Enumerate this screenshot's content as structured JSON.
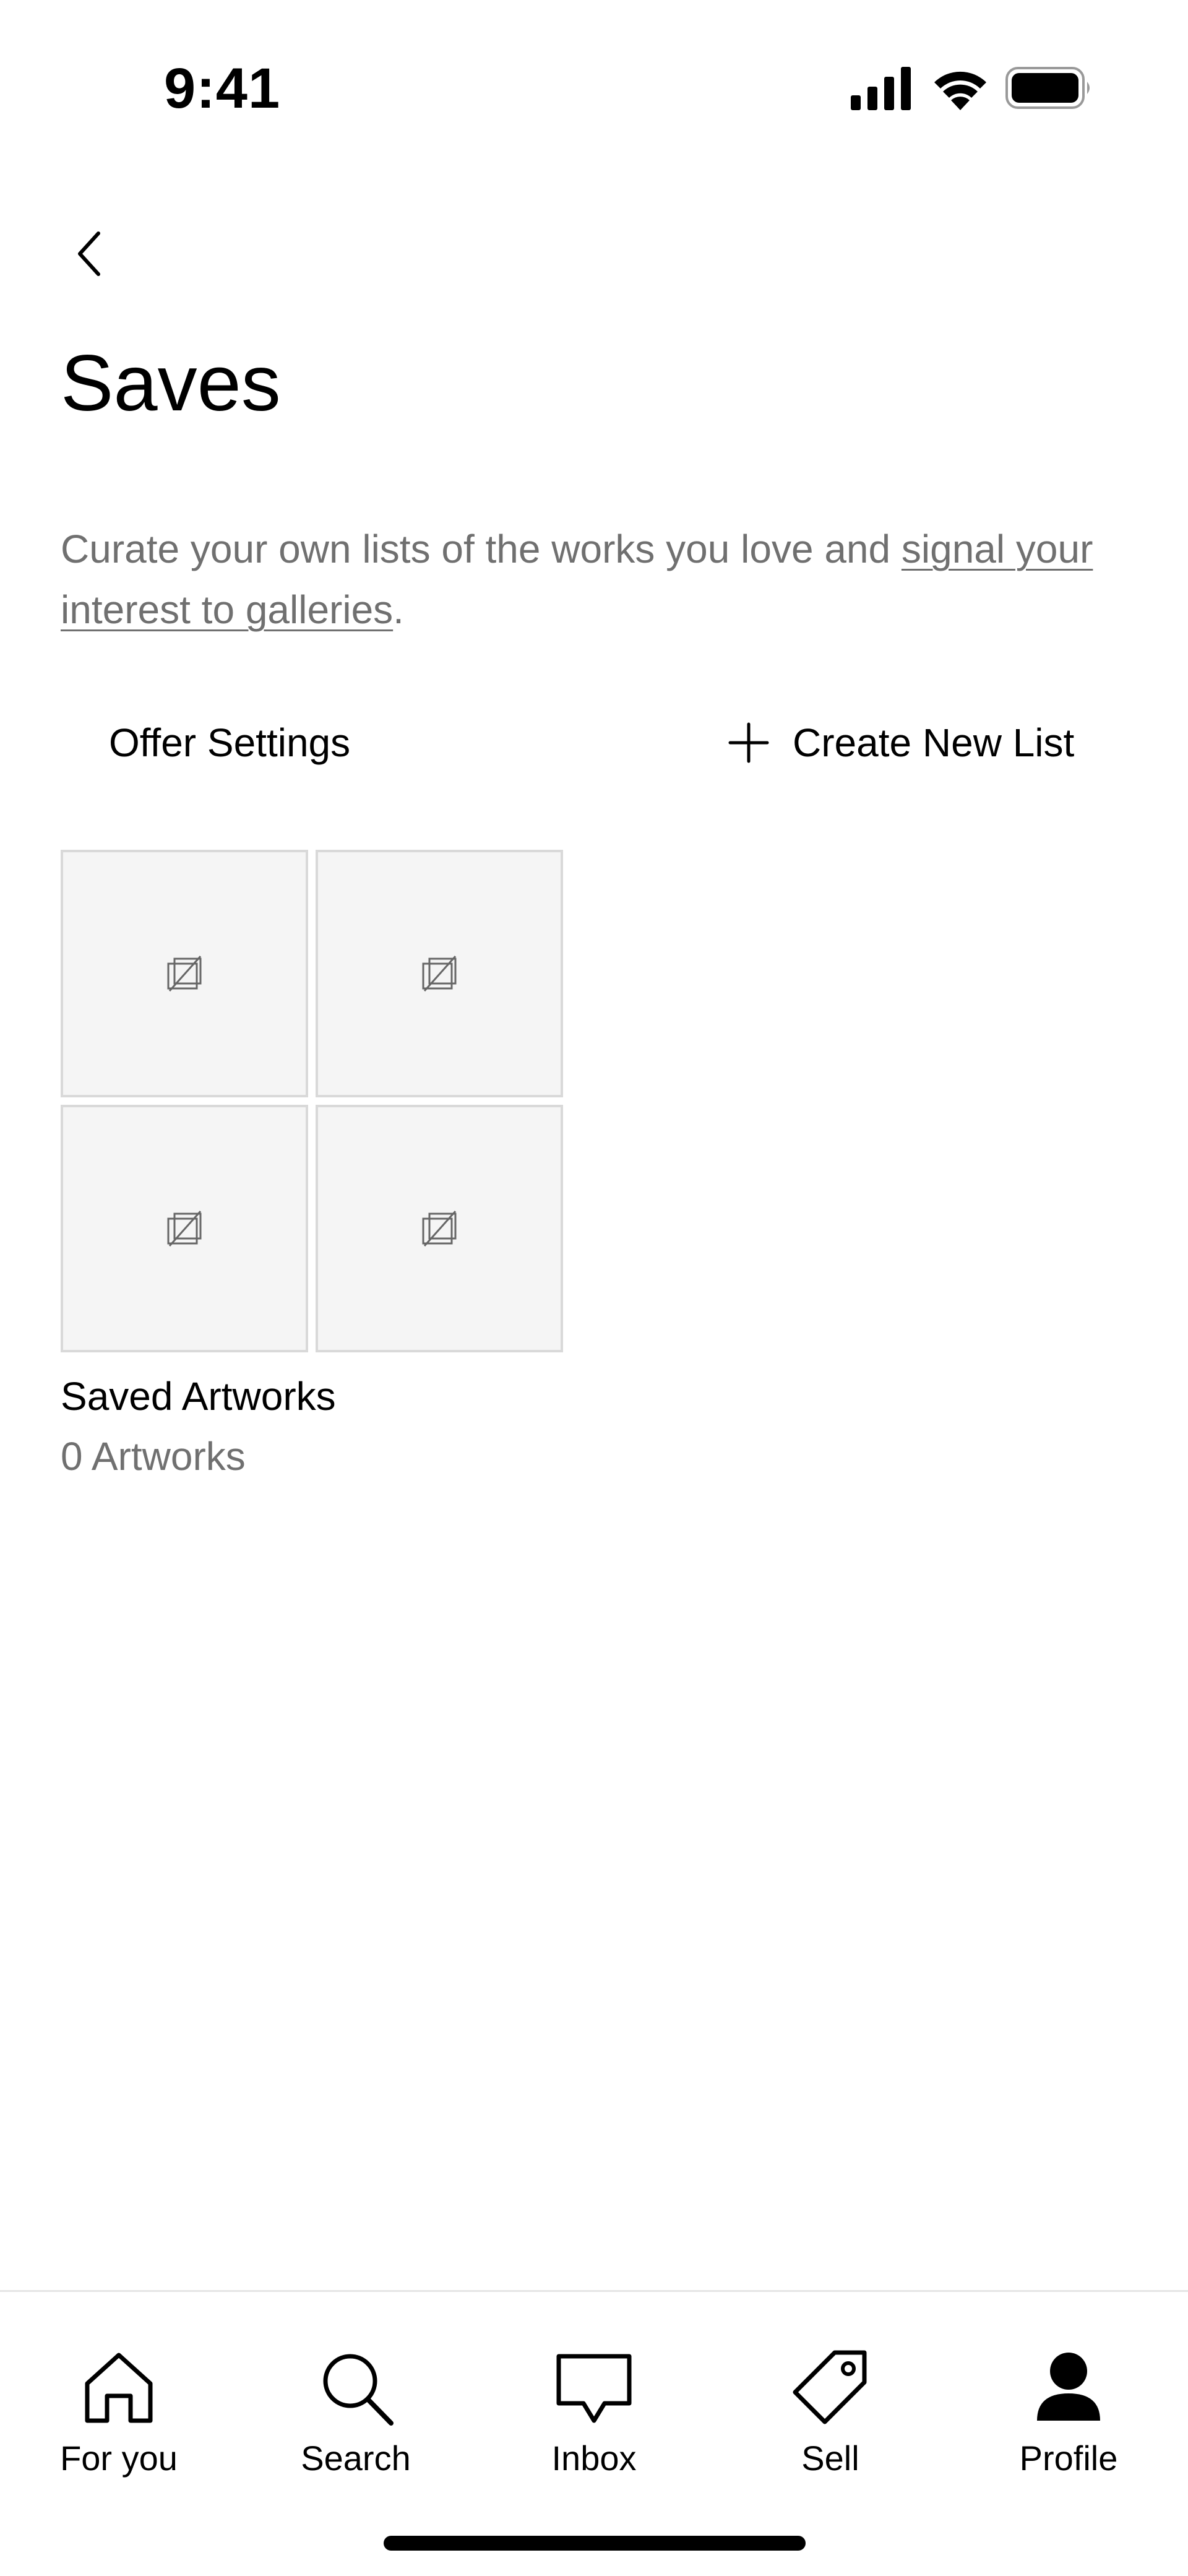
{
  "status_bar": {
    "time": "9:41",
    "icons": [
      "signal-icon",
      "wifi-icon",
      "battery-icon"
    ]
  },
  "header": {
    "back_icon": "chevron-left-icon",
    "title": "Saves"
  },
  "description": {
    "text_before": "Curate your own lists of the works you love and ",
    "link_text": "signal your interest to galleries",
    "text_after": "."
  },
  "actions": {
    "offer_settings_label": "Offer Settings",
    "create_list_label": "Create New List",
    "create_list_icon": "plus-icon"
  },
  "lists": [
    {
      "title": "Saved Artworks",
      "count_label": "0 Artworks",
      "thumbnail_icon": "image-unavailable-icon"
    }
  ],
  "bottom_nav": {
    "items": [
      {
        "label": "For you",
        "icon": "home-icon"
      },
      {
        "label": "Search",
        "icon": "search-icon"
      },
      {
        "label": "Inbox",
        "icon": "inbox-icon"
      },
      {
        "label": "Sell",
        "icon": "tag-icon"
      },
      {
        "label": "Profile",
        "icon": "profile-icon"
      }
    ],
    "active": "Profile"
  },
  "colors": {
    "text_primary": "#000000",
    "text_secondary": "#707070",
    "thumb_background": "#f5f5f5",
    "thumb_border": "#d9d9d9"
  }
}
